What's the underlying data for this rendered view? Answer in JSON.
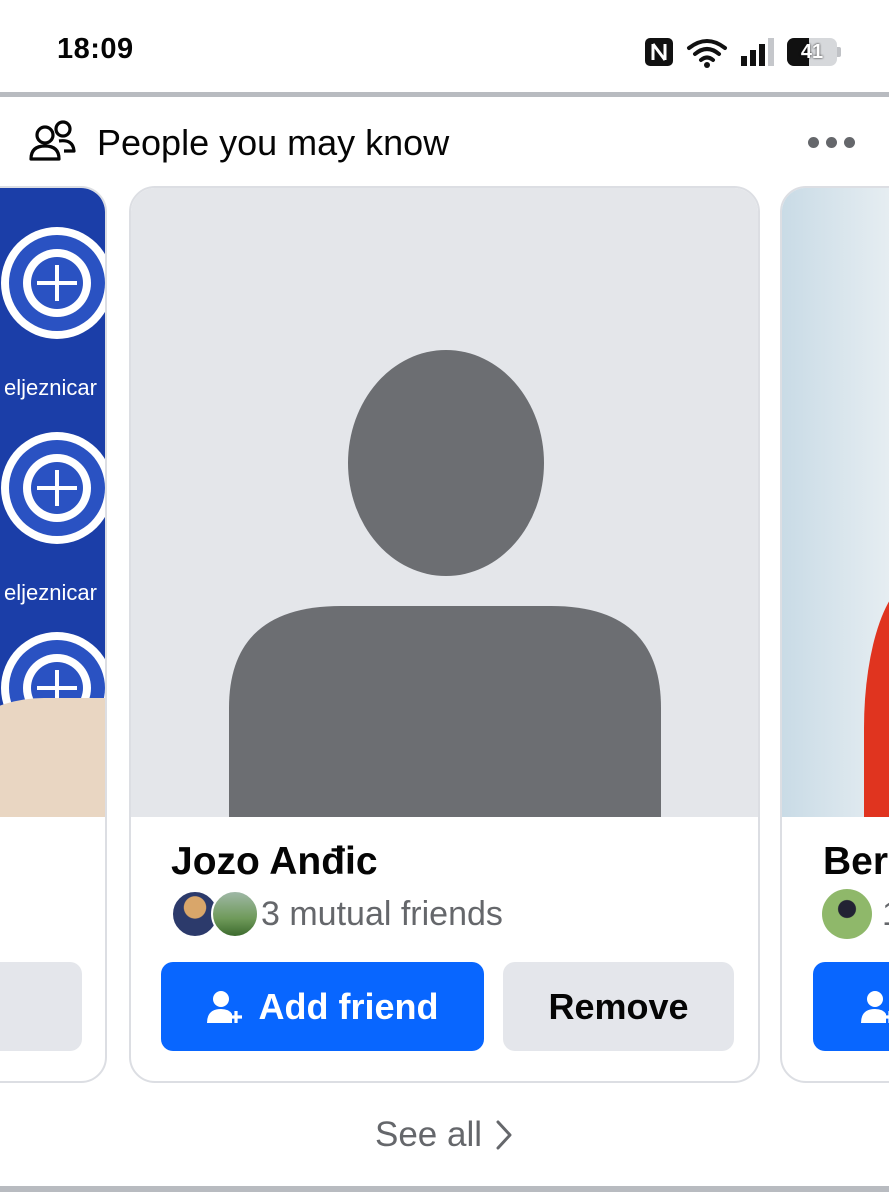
{
  "status_bar": {
    "time": "18:09",
    "battery": "41",
    "icons": [
      "nfc-icon",
      "wifi-icon",
      "signal-icon",
      "battery-icon"
    ]
  },
  "section": {
    "title": "People you may know",
    "icon": "people-icon",
    "more_icon": "more-horizontal-icon"
  },
  "cards": {
    "left": {
      "background_text_1": "eljeznicar",
      "background_text_2": "eljeznicar"
    },
    "main": {
      "name": "Jozo Anđic",
      "mutual_friends": "3 mutual friends",
      "add_label": "Add friend",
      "remove_label": "Remove"
    },
    "right": {
      "name": "Beri",
      "mutual_partial": "1"
    }
  },
  "footer": {
    "see_all_label": "See all"
  },
  "colors": {
    "accent": "#0866ff",
    "secondary_button": "#e4e6eb",
    "muted_text": "#65676b",
    "placeholder_bg": "#e4e6ea",
    "placeholder_fg": "#6c6e72"
  }
}
